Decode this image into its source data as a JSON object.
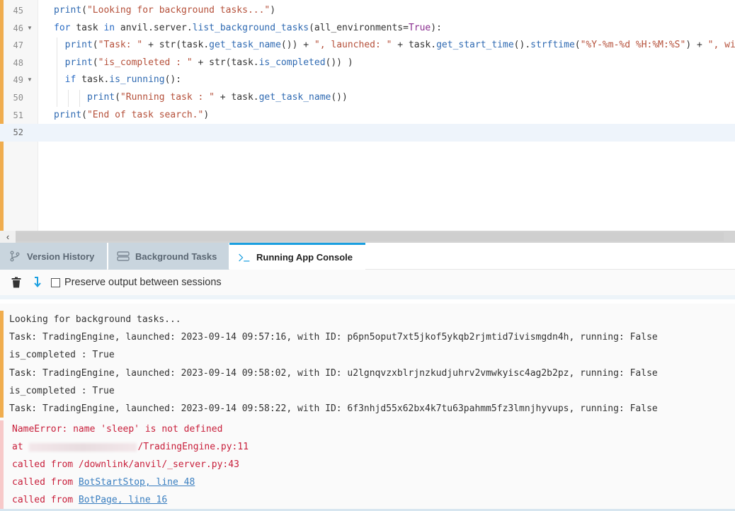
{
  "editor": {
    "lines": [
      {
        "num": "45",
        "fold": false,
        "segments": [
          {
            "t": "print",
            "c": "fn"
          },
          {
            "t": "(",
            "c": "plain"
          },
          {
            "t": "\"Looking for background tasks...\"",
            "c": "str"
          },
          {
            "t": ")",
            "c": "plain"
          }
        ]
      },
      {
        "num": "46",
        "fold": true,
        "segments": [
          {
            "t": "for",
            "c": "kw"
          },
          {
            "t": " task ",
            "c": "plain"
          },
          {
            "t": "in",
            "c": "kw"
          },
          {
            "t": " anvil.server.",
            "c": "plain"
          },
          {
            "t": "list_background_tasks",
            "c": "fn"
          },
          {
            "t": "(all_environments=",
            "c": "plain"
          },
          {
            "t": "True",
            "c": "bool"
          },
          {
            "t": "):",
            "c": "plain"
          }
        ]
      },
      {
        "num": "47",
        "fold": false,
        "segments": [
          {
            "t": "  print",
            "c": "fn"
          },
          {
            "t": "(",
            "c": "plain"
          },
          {
            "t": "\"Task: \"",
            "c": "str"
          },
          {
            "t": " + str(task.",
            "c": "plain"
          },
          {
            "t": "get_task_name",
            "c": "fn"
          },
          {
            "t": "()) + ",
            "c": "plain"
          },
          {
            "t": "\", launched: \"",
            "c": "str"
          },
          {
            "t": " + task.",
            "c": "plain"
          },
          {
            "t": "get_start_time",
            "c": "fn"
          },
          {
            "t": "().",
            "c": "plain"
          },
          {
            "t": "strftime",
            "c": "fn"
          },
          {
            "t": "(",
            "c": "plain"
          },
          {
            "t": "\"%Y-%m-%d %H:%M:%S\"",
            "c": "str"
          },
          {
            "t": ") + ",
            "c": "plain"
          },
          {
            "t": "\", with",
            "c": "str"
          }
        ]
      },
      {
        "num": "48",
        "fold": false,
        "segments": [
          {
            "t": "  print",
            "c": "fn"
          },
          {
            "t": "(",
            "c": "plain"
          },
          {
            "t": "\"is_completed : \"",
            "c": "str"
          },
          {
            "t": " + str(task.",
            "c": "plain"
          },
          {
            "t": "is_completed",
            "c": "fn"
          },
          {
            "t": "()) )",
            "c": "plain"
          }
        ]
      },
      {
        "num": "49",
        "fold": true,
        "segments": [
          {
            "t": "  if",
            "c": "kw"
          },
          {
            "t": " task.",
            "c": "plain"
          },
          {
            "t": "is_running",
            "c": "fn"
          },
          {
            "t": "():",
            "c": "plain"
          }
        ]
      },
      {
        "num": "50",
        "fold": false,
        "segments": [
          {
            "t": "      print",
            "c": "fn"
          },
          {
            "t": "(",
            "c": "plain"
          },
          {
            "t": "\"Running task : \"",
            "c": "str"
          },
          {
            "t": " + task.",
            "c": "plain"
          },
          {
            "t": "get_task_name",
            "c": "fn"
          },
          {
            "t": "())",
            "c": "plain"
          }
        ]
      },
      {
        "num": "51",
        "fold": false,
        "segments": [
          {
            "t": "print",
            "c": "fn"
          },
          {
            "t": "(",
            "c": "plain"
          },
          {
            "t": "\"End of task search.\"",
            "c": "str"
          },
          {
            "t": ")",
            "c": "plain"
          }
        ]
      },
      {
        "num": "52",
        "fold": false,
        "active": true,
        "segments": []
      }
    ]
  },
  "scrollbar": {
    "left_arrow": "‹"
  },
  "tabs": [
    {
      "label": "Version History",
      "icon": "branch-icon",
      "active": false
    },
    {
      "label": "Background Tasks",
      "icon": "server-icon",
      "active": false
    },
    {
      "label": "Running App Console",
      "icon": "terminal-icon",
      "active": true
    }
  ],
  "toolbar": {
    "preserve_label": "Preserve output between sessions",
    "preserve_checked": false
  },
  "console": {
    "output": [
      "Looking for background tasks...",
      "Task: TradingEngine, launched: 2023-09-14 09:57:16, with ID: p6pn5oput7xt5jkof5ykqb2rjmtid7ivismgdn4h, running: False",
      "is_completed : True",
      "Task: TradingEngine, launched: 2023-09-14 09:58:02, with ID: u2lgnqvzxblrjnzkudjuhrv2vmwkyisc4ag2b2pz, running: False",
      "is_completed : True",
      "Task: TradingEngine, launched: 2023-09-14 09:58:22, with ID: 6f3nhjd55x62bx4k7tu63pahmm5fz3lmnjhyvups, running: False"
    ],
    "error": {
      "message": "NameError: name 'sleep' is not defined",
      "at_prefix": "at ",
      "at_suffix": "/TradingEngine.py:11",
      "frames": [
        {
          "prefix": "called from ",
          "text": "/downlink/anvil/_server.py:43",
          "link": false
        },
        {
          "prefix": "called from ",
          "text": "BotStartStop, line 48",
          "link": true
        },
        {
          "prefix": "called from ",
          "text": "BotPage, line 16",
          "link": true
        }
      ]
    }
  },
  "colors": {
    "accent": "#1a9fe0",
    "output_marker": "#f0ad4e",
    "error_text": "#c81e3a",
    "link": "#3a7fc0"
  }
}
